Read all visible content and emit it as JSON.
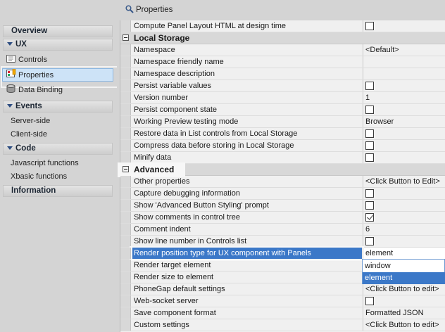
{
  "title": "Properties",
  "sidebar": {
    "overview": "Overview",
    "ux": "UX",
    "controls": "Controls",
    "properties": "Properties",
    "data_binding": "Data Binding",
    "events": "Events",
    "server_side": "Server-side",
    "client_side": "Client-side",
    "code": "Code",
    "javascript_functions": "Javascript functions",
    "xbasic_functions": "Xbasic functions",
    "information": "Information"
  },
  "rows": {
    "compute": {
      "name": "Compute Panel Layout HTML at design time",
      "checked": false
    },
    "local_storage_section": "Local Storage",
    "namespace": {
      "name": "Namespace",
      "value": "<Default>"
    },
    "namespace_friendly": {
      "name": "Namespace friendly name",
      "value": ""
    },
    "namespace_desc": {
      "name": "Namespace description",
      "value": ""
    },
    "persist_variable": {
      "name": "Persist variable values",
      "checked": false
    },
    "version_number": {
      "name": "Version number",
      "value": "1"
    },
    "persist_component": {
      "name": "Persist component state",
      "checked": false
    },
    "working_preview": {
      "name": "Working Preview testing mode",
      "value": "Browser"
    },
    "restore_data": {
      "name": "Restore data in List controls from Local Storage",
      "checked": false
    },
    "compress_data": {
      "name": "Compress data before storing in Local Storage",
      "checked": false
    },
    "minify_data": {
      "name": "Minify data",
      "checked": false
    },
    "advanced_section": "Advanced",
    "other_properties": {
      "name": "Other properties",
      "value": "<Click Button to Edit>"
    },
    "capture_debug": {
      "name": "Capture debugging information",
      "checked": false
    },
    "show_adv_button": {
      "name": "Show 'Advanced Button Styling' prompt",
      "checked": false
    },
    "show_comments": {
      "name": "Show comments in control tree",
      "checked": true
    },
    "comment_indent": {
      "name": "Comment indent",
      "value": "6"
    },
    "show_line_number": {
      "name": "Show line number in Controls list",
      "checked": false
    },
    "render_position": {
      "name": "Render position type for UX component with Panels",
      "value": "element"
    },
    "render_target": {
      "name": "Render target element",
      "value": ""
    },
    "render_size": {
      "name": "Render size to element",
      "value": ""
    },
    "phonegap": {
      "name": "PhoneGap default settings",
      "value": "<Click Button to edit>"
    },
    "websocket": {
      "name": "Web-socket server",
      "checked": false
    },
    "save_format": {
      "name": "Save component format",
      "value": "Formatted JSON"
    },
    "custom_settings": {
      "name": "Custom settings",
      "value": "<Click Button to edit>"
    }
  },
  "dropdown": {
    "options": [
      "window",
      "element"
    ],
    "selected": "element"
  }
}
